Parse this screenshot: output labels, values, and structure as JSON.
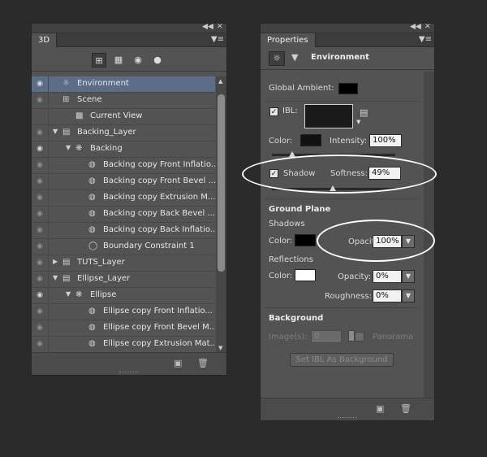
{
  "panel3d": {
    "tab": "3D",
    "rows": [
      {
        "label": "Environment",
        "indent": 0,
        "tri": "",
        "icon": "env",
        "selected": true,
        "eye": "on"
      },
      {
        "label": "Scene",
        "indent": 0,
        "tri": "",
        "icon": "scene",
        "selected": false,
        "eye": "dim"
      },
      {
        "label": "Current View",
        "indent": 1,
        "tri": "",
        "icon": "camera",
        "selected": false,
        "eye": "none"
      },
      {
        "label": "Backing_Layer",
        "indent": 0,
        "tri": "down",
        "icon": "folder",
        "selected": false,
        "eye": "dim"
      },
      {
        "label": "Backing",
        "indent": 1,
        "tri": "down",
        "icon": "mesh",
        "selected": false,
        "eye": "on"
      },
      {
        "label": "Backing copy Front Inflatio...",
        "indent": 2,
        "tri": "",
        "icon": "material",
        "selected": false,
        "eye": "dim"
      },
      {
        "label": "Backing copy Front Bevel ...",
        "indent": 2,
        "tri": "",
        "icon": "material",
        "selected": false,
        "eye": "dim"
      },
      {
        "label": "Backing copy Extrusion M...",
        "indent": 2,
        "tri": "",
        "icon": "material",
        "selected": false,
        "eye": "dim"
      },
      {
        "label": "Backing copy Back Bevel ...",
        "indent": 2,
        "tri": "",
        "icon": "material",
        "selected": false,
        "eye": "dim"
      },
      {
        "label": "Backing copy Back Inflatio...",
        "indent": 2,
        "tri": "",
        "icon": "material",
        "selected": false,
        "eye": "dim"
      },
      {
        "label": "Boundary Constraint 1",
        "indent": 2,
        "tri": "",
        "icon": "constraint",
        "selected": false,
        "eye": "dim"
      },
      {
        "label": "TUTS_Layer",
        "indent": 0,
        "tri": "right",
        "icon": "folder",
        "selected": false,
        "eye": "dim"
      },
      {
        "label": "Ellipse_Layer",
        "indent": 0,
        "tri": "down",
        "icon": "folder",
        "selected": false,
        "eye": "dim"
      },
      {
        "label": "Ellipse",
        "indent": 1,
        "tri": "down",
        "icon": "mesh",
        "selected": false,
        "eye": "on"
      },
      {
        "label": "Ellipse copy Front Inflatio...",
        "indent": 2,
        "tri": "",
        "icon": "material",
        "selected": false,
        "eye": "dim"
      },
      {
        "label": "Ellipse copy Front Bevel M...",
        "indent": 2,
        "tri": "",
        "icon": "material",
        "selected": false,
        "eye": "dim"
      },
      {
        "label": "Ellipse copy Extrusion Mat...",
        "indent": 2,
        "tri": "",
        "icon": "material",
        "selected": false,
        "eye": "dim"
      }
    ]
  },
  "properties": {
    "tab": "Properties",
    "header_title": "Environment",
    "global_ambient_label": "Global Ambient:",
    "ibl_label": "IBL:",
    "color_label": "Color:",
    "intensity_label": "Intensity:",
    "intensity_value": "100%",
    "shadow_label": "Shadow",
    "softness_label": "Softness:",
    "softness_value": "49%",
    "ground_plane_label": "Ground Plane",
    "shadows_label": "Shadows",
    "shadows_color_label": "Color:",
    "shadows_opacity_label": "Opacity:",
    "shadows_opacity_value": "100%",
    "reflections_label": "Reflections",
    "reflections_color_label": "Color:",
    "reflections_opacity_label": "Opacity:",
    "reflections_opacity_value": "0%",
    "roughness_label": "Roughness:",
    "roughness_value": "0%",
    "background_label": "Background",
    "images_label": "Image(s):",
    "images_value": "0",
    "panorama_label": "Panorama",
    "set_ibl_button": "Set IBL As Background"
  },
  "colors": {
    "global_ambient": "#000000",
    "ibl_preview": "#1a1a1a",
    "color_swatch": "#111111",
    "shadow_color": "#000000",
    "reflection_color": "#ffffff",
    "selected_row": "#5c6d87"
  }
}
